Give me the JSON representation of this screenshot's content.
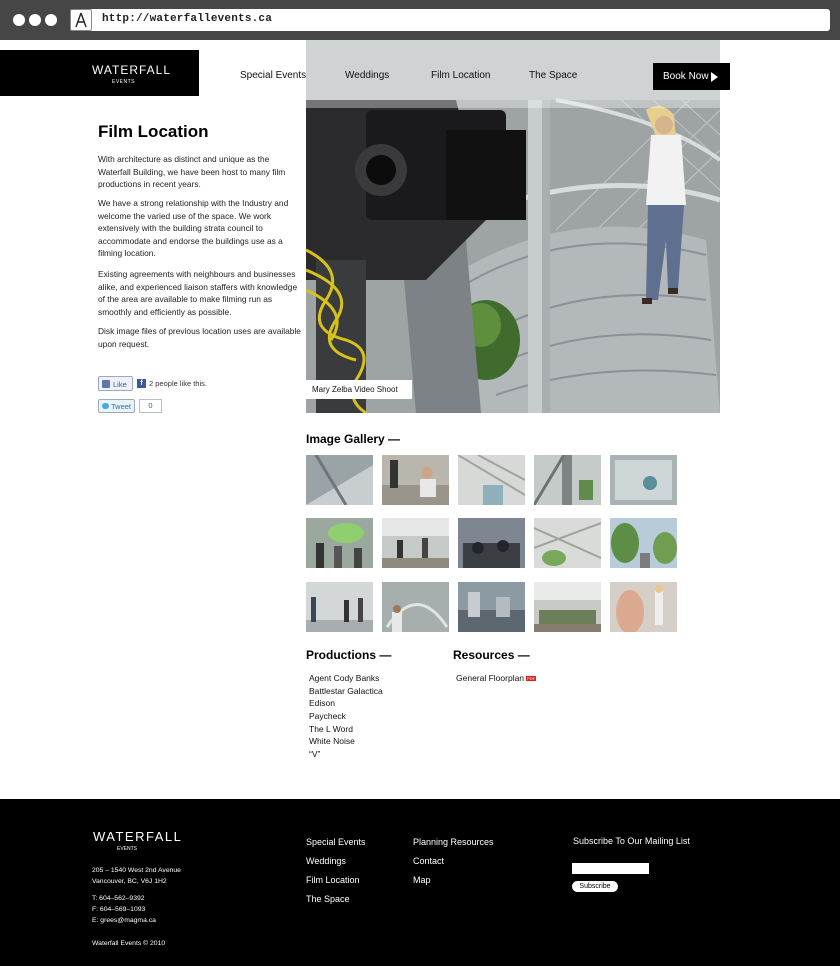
{
  "browser": {
    "url": "http://waterfallevents.ca"
  },
  "header": {
    "logo_text": "WATERFALL",
    "logo_sub": "EVENTS",
    "nav": [
      {
        "label": "Special Events"
      },
      {
        "label": "Weddings"
      },
      {
        "label": "Film Location"
      },
      {
        "label": "The Space"
      }
    ],
    "book_label": "Book Now"
  },
  "main": {
    "title": "Film Location",
    "paragraphs": [
      "With architecture as distinct and unique as the Waterfall Building, we have been host to many film productions in recent years.",
      "We have a strong relationship with the Industry and welcome the varied use of the space. We work extensively with the building strata council to accommodate and endorse the buildings use as a filming location.",
      "Existing agreements with neighbours and businesses alike, and experienced liaison staffers with knowledge of the area are available to make filming run as smoothly and efficiently as possible.",
      "Disk image files of previous location uses are available upon request."
    ],
    "social": {
      "like_label": "Like",
      "like_text": "2 people like this.",
      "tweet_label": "Tweet",
      "tweet_count": "0"
    },
    "hero_caption": "Mary Zelba Video Shoot"
  },
  "gallery": {
    "title": "Image Gallery —",
    "thumb_count": 15
  },
  "productions": {
    "title": "Productions —",
    "items": [
      "Agent Cody Banks",
      "Battlestar Galactica",
      "Edison",
      "Paycheck",
      "The L Word",
      "White Noise",
      "“V”"
    ]
  },
  "resources": {
    "title": "Resources —",
    "items": [
      {
        "label": "General Floorplan",
        "badge": "PDF"
      }
    ]
  },
  "footer": {
    "logo_text": "WATERFALL",
    "logo_sub": "EVENTS",
    "address": [
      "205 – 1540 West 2nd Avenue",
      "Vancouver, BC, V6J 1H2"
    ],
    "contact": [
      "T: 604–562–9392",
      "F: 604–569–1093",
      "E: grees@magma.ca"
    ],
    "copyright": "Waterfall Events  ©  2010",
    "links_col1": [
      "Special Events",
      "Weddings",
      "Film Location",
      "The Space"
    ],
    "links_col2": [
      "Planning Resources",
      "Contact",
      "Map"
    ],
    "subscribe_title": "Subscribe To Our Mailing List",
    "subscribe_button": "Subscribe"
  },
  "colors": {
    "black": "#000000",
    "chrome": "#464646",
    "facebook": "#3b5998",
    "twitter": "#45a9e0"
  }
}
